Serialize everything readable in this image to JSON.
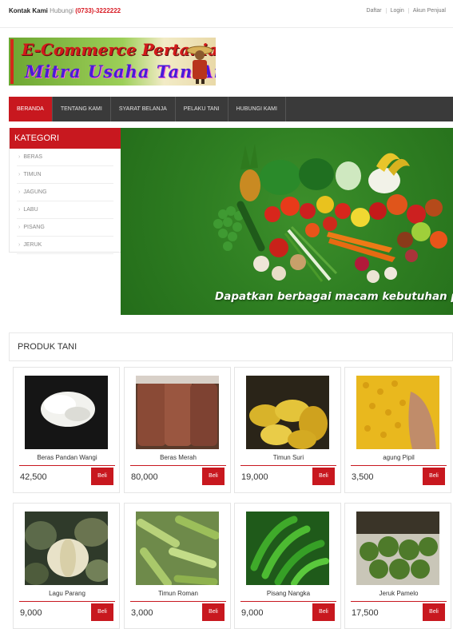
{
  "topbar": {
    "contact_label": "Kontak Kami",
    "contact_text": "Hubungi",
    "contact_phone": "(0733)-3222222",
    "links": [
      "Daftar",
      "Login",
      "Akun Penjual"
    ]
  },
  "logo": {
    "line1": "E-Commerce Pertanian",
    "line2": "Mitra Usaha TaniAnda"
  },
  "nav": {
    "items": [
      "BERANDA",
      "TENTANG KAMI",
      "SYARAT BELANJA",
      "PELAKU TANI",
      "HUBUNGI KAMI"
    ],
    "active": "BERANDA"
  },
  "sidebar": {
    "title": "KATEGORI",
    "items": [
      "BERAS",
      "TIMUN",
      "JAGUNG",
      "LABU",
      "PISANG",
      "JERUK"
    ]
  },
  "banner": {
    "tagline": "Dapatkan berbagai macam kebutuhan pokok anda disini"
  },
  "products": {
    "title": "PRODUK TANI",
    "buy_label": "Beli",
    "items": [
      {
        "name": "Beras Pandan Wangi",
        "price": "42,500"
      },
      {
        "name": "Beras Merah",
        "price": "80,000"
      },
      {
        "name": "Timun Suri",
        "price": "19,000"
      },
      {
        "name": "agung Pipil",
        "price": "3,500"
      },
      {
        "name": "Lagu Parang",
        "price": "9,000"
      },
      {
        "name": "Timun Roman",
        "price": "3,000"
      },
      {
        "name": "Pisang Nangka",
        "price": "9,000"
      },
      {
        "name": "Jeruk Pamelo",
        "price": "17,500"
      }
    ]
  },
  "colors": {
    "accent": "#c8181f",
    "nav_bg": "#3a3a3a",
    "banner_green": "#2f7f22"
  }
}
